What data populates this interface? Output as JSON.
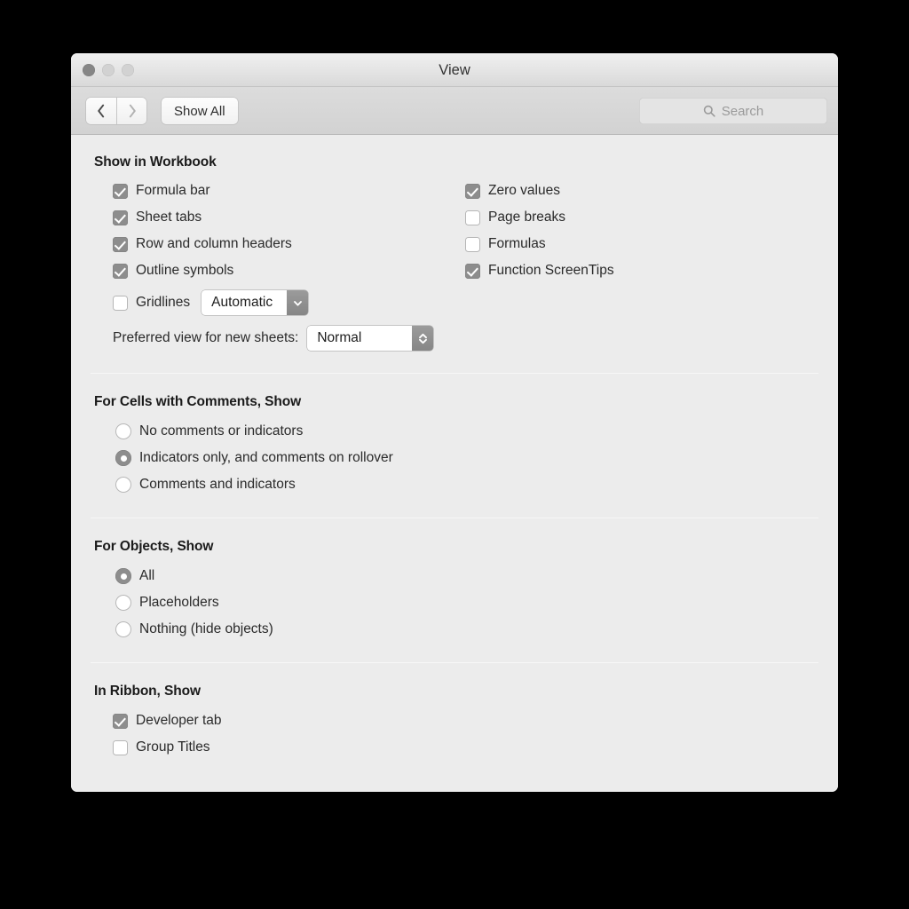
{
  "window": {
    "title": "View",
    "traffic_lights": [
      "close",
      "minimize",
      "zoom"
    ]
  },
  "toolbar": {
    "back_icon": "chevron-left-icon",
    "forward_icon": "chevron-right-icon",
    "show_all_label": "Show All",
    "search": {
      "icon": "search-icon",
      "placeholder": "Search",
      "value": ""
    }
  },
  "sections": {
    "show_in_workbook": {
      "title": "Show in Workbook",
      "left_checkboxes": [
        {
          "label": "Formula bar",
          "checked": true
        },
        {
          "label": "Sheet tabs",
          "checked": true
        },
        {
          "label": "Row and column headers",
          "checked": true
        },
        {
          "label": "Outline symbols",
          "checked": true
        }
      ],
      "right_checkboxes": [
        {
          "label": "Zero values",
          "checked": true
        },
        {
          "label": "Page breaks",
          "checked": false
        },
        {
          "label": "Formulas",
          "checked": false
        },
        {
          "label": "Function ScreenTips",
          "checked": true
        }
      ],
      "gridlines": {
        "label": "Gridlines",
        "checked": false,
        "color_popup_value": "Automatic",
        "color_popup_icon": "chevron-down-icon"
      },
      "preferred_view": {
        "label": "Preferred view for new sheets:",
        "value": "Normal",
        "icon": "chevron-up-down-icon"
      }
    },
    "cells_with_comments": {
      "title": "For Cells with Comments, Show",
      "options": [
        {
          "label": "No comments or indicators",
          "selected": false
        },
        {
          "label": "Indicators only, and comments on rollover",
          "selected": true
        },
        {
          "label": "Comments and indicators",
          "selected": false
        }
      ]
    },
    "for_objects": {
      "title": "For Objects, Show",
      "options": [
        {
          "label": "All",
          "selected": true
        },
        {
          "label": "Placeholders",
          "selected": false
        },
        {
          "label": "Nothing (hide objects)",
          "selected": false
        }
      ]
    },
    "in_ribbon": {
      "title": "In Ribbon, Show",
      "checkboxes": [
        {
          "label": "Developer tab",
          "checked": true
        },
        {
          "label": "Group Titles",
          "checked": false
        }
      ]
    }
  },
  "colors": {
    "window_background": "#ececec",
    "titlebar_top": "#f0f0f0",
    "toolbar": "#d6d6d6",
    "control_gray": "#8d8d8d",
    "text": "#2a2a2a",
    "divider": "#dcdcdc",
    "desktop": "#000000"
  }
}
